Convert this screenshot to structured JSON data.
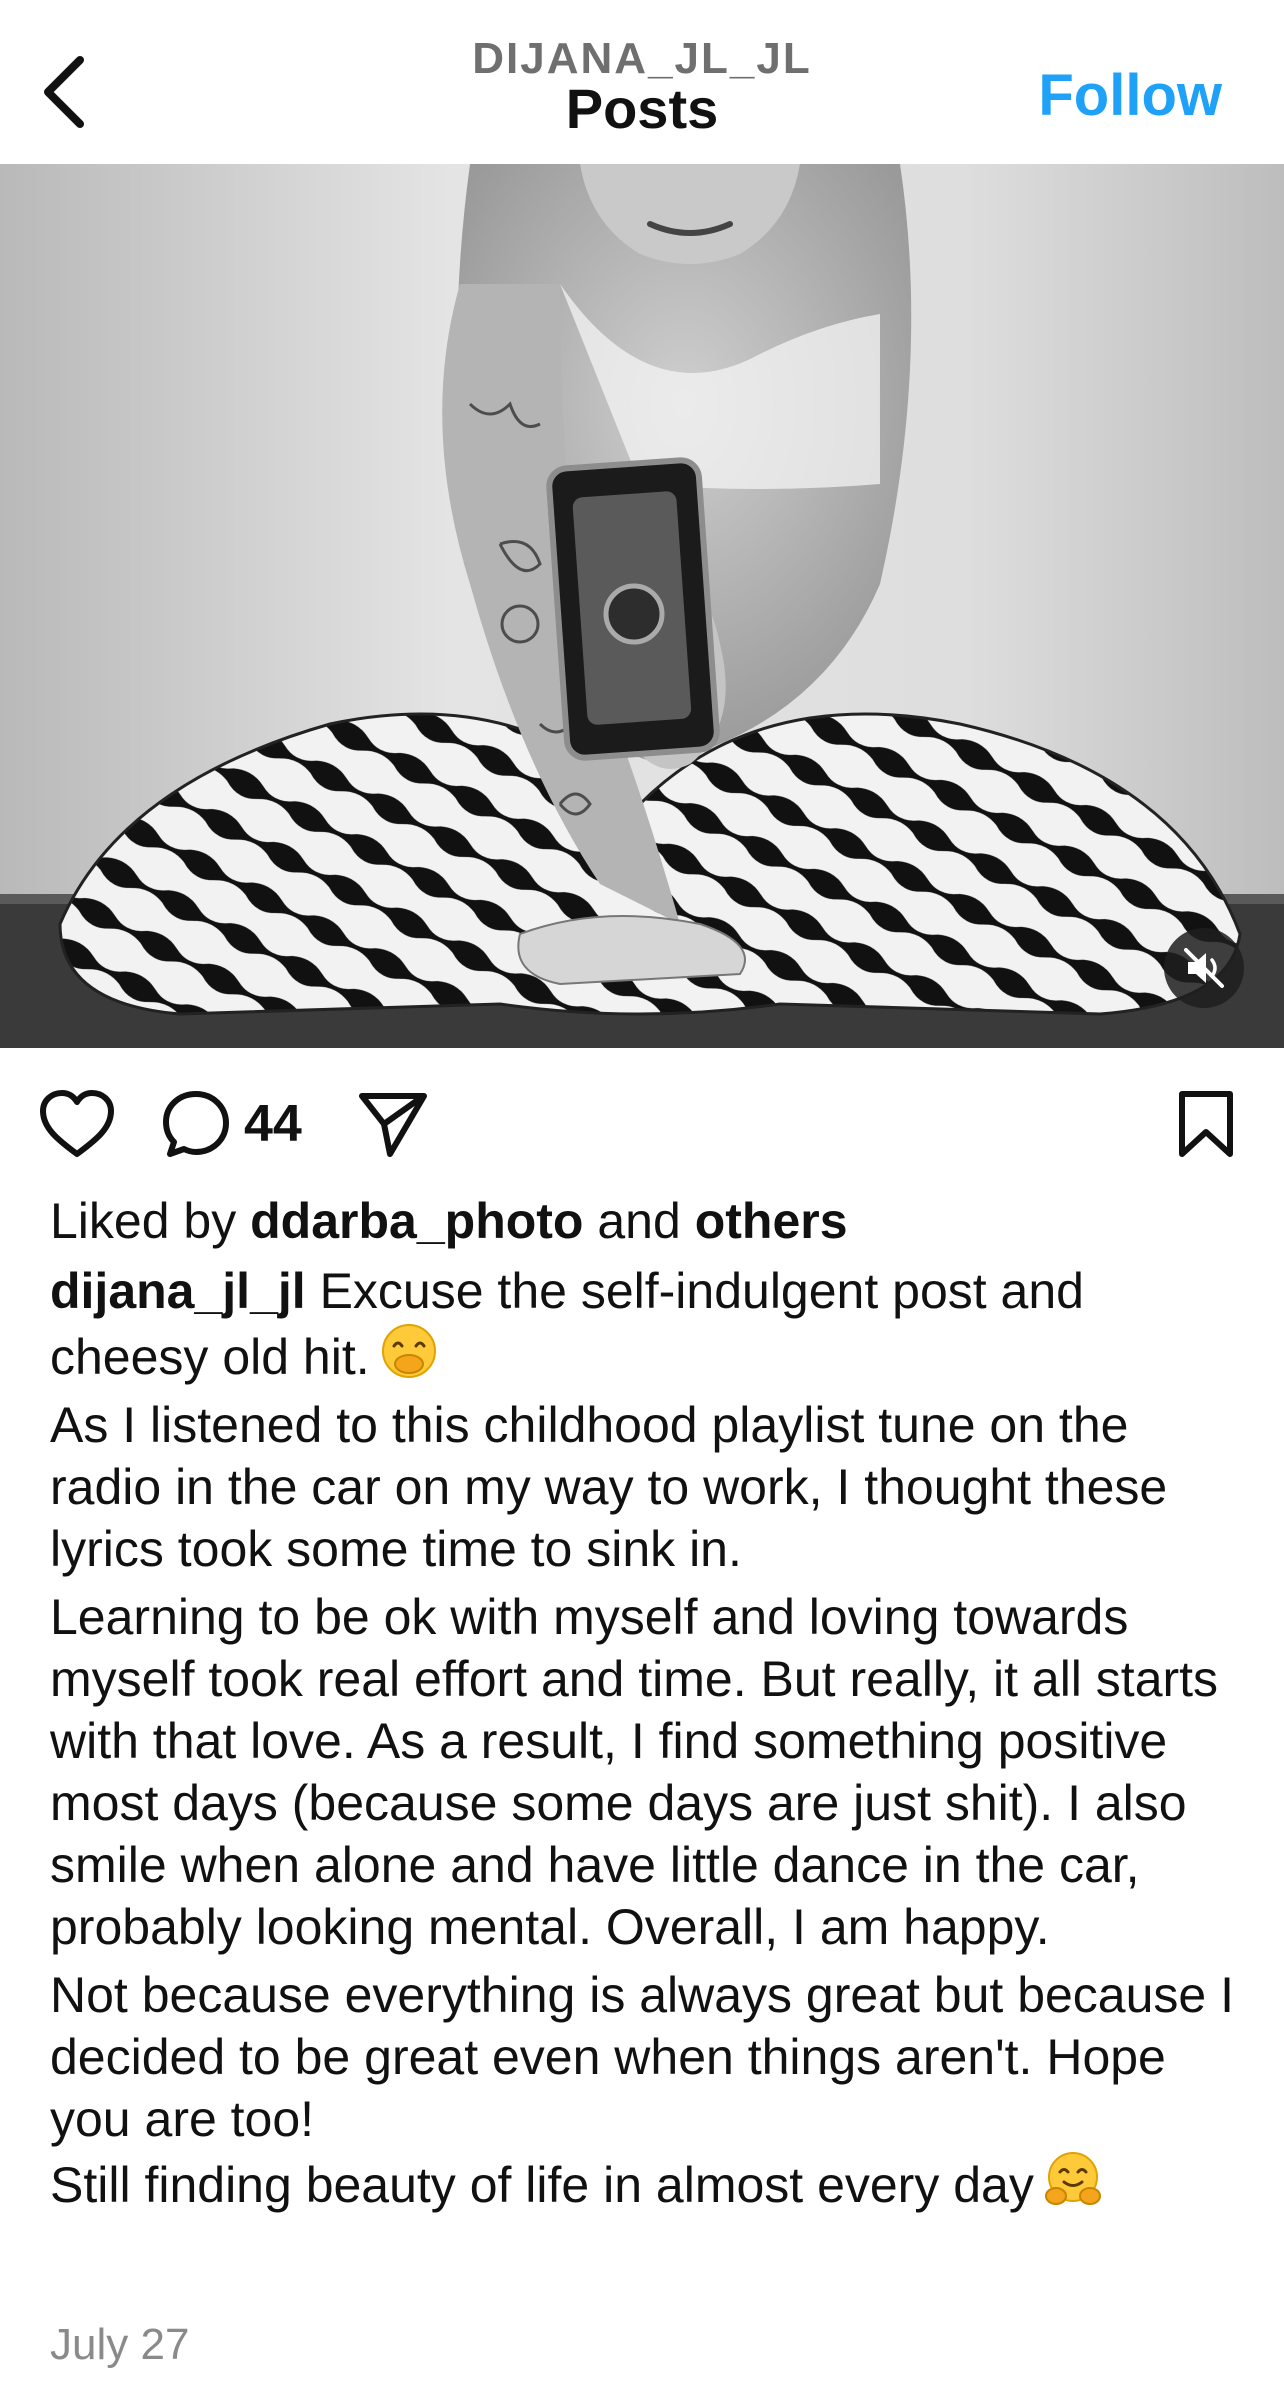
{
  "header": {
    "username": "DIJANA_JL_JL",
    "title": "Posts",
    "follow_label": "Follow"
  },
  "icons": {
    "back": "chevron-left-icon",
    "like": "heart-icon",
    "comment": "comment-bubble-icon",
    "share": "paper-plane-icon",
    "save": "bookmark-icon",
    "mute": "speaker-muted-icon"
  },
  "colors": {
    "accent": "#1ea1f7",
    "text": "#111111",
    "secondary": "#8a8a8a"
  },
  "actions": {
    "comment_count": "44"
  },
  "likes": {
    "prefix": "Liked by",
    "user": "ddarba_photo",
    "connector": "and",
    "others": "others"
  },
  "caption": {
    "author": "dijana_jl_jl",
    "first_text": "Excuse the self-indulgent post and cheesy old hit.",
    "first_emoji": "face-with-hand-over-mouth",
    "paragraphs": [
      "As I listened to this childhood playlist tune on the radio in the car on my way to work, I thought these lyrics took some time to sink in.",
      "Learning to be ok with myself and loving towards myself took real effort and time. But really, it all starts with that love. As a result, I find something positive most days (because some days are just shit). I also smile when alone and have little dance in the car, probably looking mental. Overall, I am happy.",
      "Not because everything is always great but because I decided to be great even when things aren't. Hope you are too!"
    ],
    "last_text": "Still finding beauty of life in almost every day",
    "last_emoji": "hugging-face"
  },
  "date": "July 27"
}
